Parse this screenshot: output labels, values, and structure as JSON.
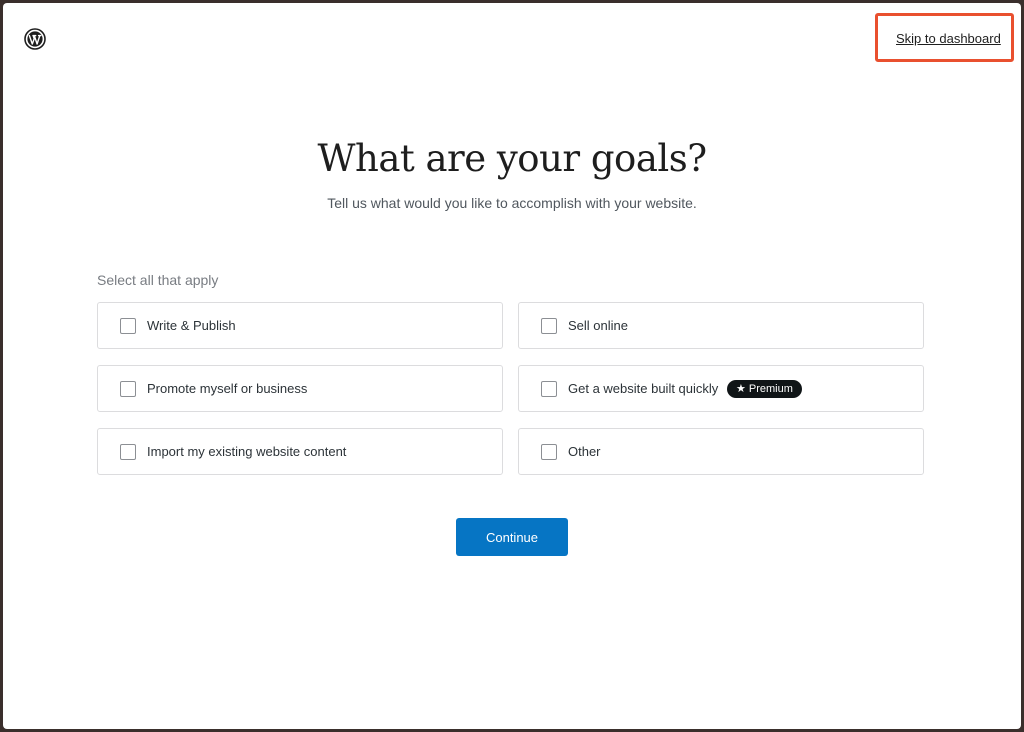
{
  "header": {
    "logo_icon": "wordpress-logo-icon",
    "skip_link": "Skip to dashboard",
    "highlight_color": "#e9502f"
  },
  "main": {
    "title": "What are your goals?",
    "subtitle": "Tell us what would you like to accomplish with your website.",
    "select_label": "Select all that apply",
    "goals": [
      {
        "label": "Write & Publish",
        "checked": false
      },
      {
        "label": "Sell online",
        "checked": false
      },
      {
        "label": "Promote myself or business",
        "checked": false
      },
      {
        "label": "Get a website built quickly",
        "checked": false,
        "badge": "Premium",
        "badge_icon": "star-icon"
      },
      {
        "label": "Import my existing website content",
        "checked": false
      },
      {
        "label": "Other",
        "checked": false
      }
    ],
    "continue_label": "Continue",
    "accent_color": "#0675c4"
  }
}
